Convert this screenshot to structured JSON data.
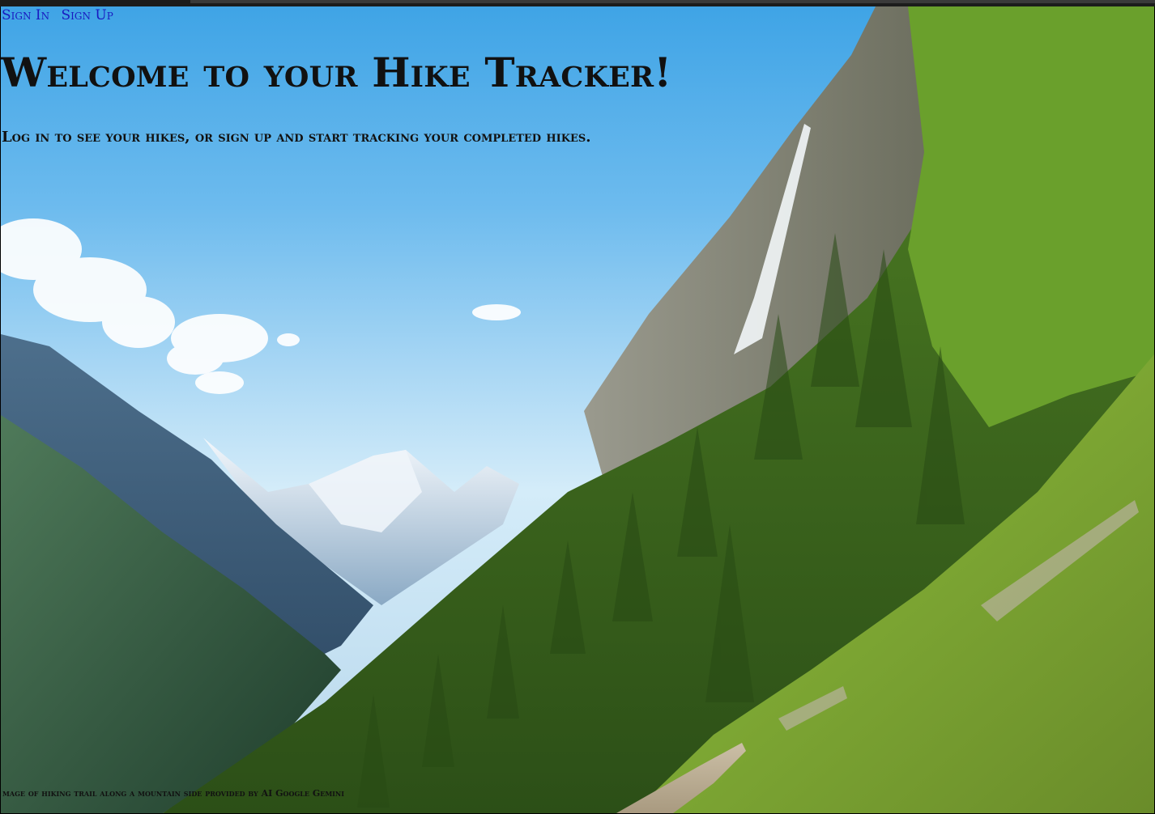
{
  "nav": {
    "sign_in": "Sign In",
    "sign_up": "Sign Up"
  },
  "page": {
    "title": "Welcome to your Hike Tracker!",
    "subtitle": "Log in to see your hikes, or sign up and start tracking your completed hikes."
  },
  "footer": {
    "credit": "mage of hiking trail along a mountain side provided by AI Google Gemini"
  },
  "colors": {
    "link": "#1a1ac0",
    "text": "#111111",
    "sky": "#3fa4e6",
    "forest": "#3f6b1f"
  }
}
